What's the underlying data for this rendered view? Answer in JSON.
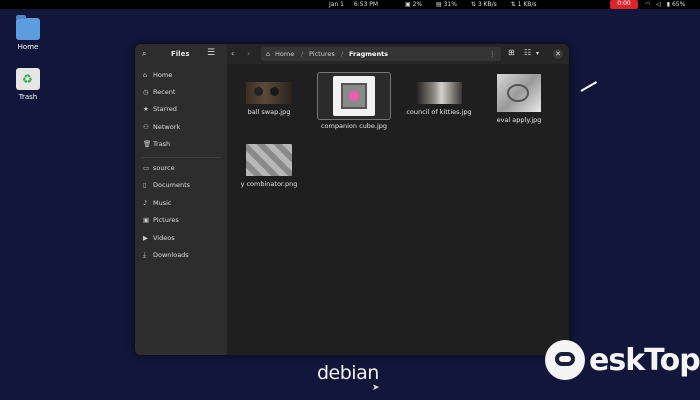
{
  "topbar": {
    "date": "Jan 1",
    "time": "6:53 PM",
    "cpu": "2%",
    "mem": "31%",
    "net_down": "3 KB/s",
    "net_up": "1 KB/s",
    "rec_time": "0:00",
    "battery": "65%"
  },
  "desktop": {
    "home_label": "Home",
    "trash_label": "Trash"
  },
  "sidebar": {
    "title": "Files",
    "items": [
      {
        "label": "Home",
        "icon": "home-icon",
        "glyph": "⌂"
      },
      {
        "label": "Recent",
        "icon": "clock-icon",
        "glyph": "◷"
      },
      {
        "label": "Starred",
        "icon": "star-icon",
        "glyph": "★"
      },
      {
        "label": "Network",
        "icon": "network-icon",
        "glyph": "⚇"
      },
      {
        "label": "Trash",
        "icon": "trash-icon",
        "glyph": "🗑"
      },
      {
        "label": "source",
        "icon": "folder-icon",
        "glyph": "▭"
      },
      {
        "label": "Documents",
        "icon": "document-icon",
        "glyph": "▯"
      },
      {
        "label": "Music",
        "icon": "music-icon",
        "glyph": "♪"
      },
      {
        "label": "Pictures",
        "icon": "picture-icon",
        "glyph": "▣"
      },
      {
        "label": "Videos",
        "icon": "video-icon",
        "glyph": "▶"
      },
      {
        "label": "Downloads",
        "icon": "download-icon",
        "glyph": "⤓"
      }
    ]
  },
  "pathbar": {
    "home": "Home",
    "pictures": "Pictures",
    "current": "Fragments"
  },
  "files": [
    {
      "name": "ball swap.jpg",
      "selected": false
    },
    {
      "name": "companion cube.jpg",
      "selected": true
    },
    {
      "name": "council of kitties.jpg",
      "selected": false
    },
    {
      "name": "eval apply.jpg",
      "selected": false
    },
    {
      "name": "y combinator.png",
      "selected": false
    }
  ],
  "branding": {
    "os_logo": "debian",
    "watermark": "eskTop"
  },
  "colors": {
    "desktop_bg": "#12163a",
    "window_bg": "#242424",
    "sidebar_bg": "#2d2d2d",
    "record_red": "#d9262d"
  }
}
